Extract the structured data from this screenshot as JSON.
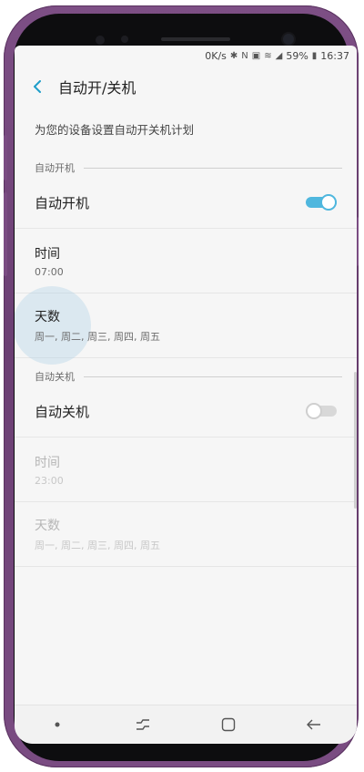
{
  "status_bar": {
    "net_speed": "0K/s",
    "battery": "59%",
    "time": "16:37"
  },
  "app_bar": {
    "title": "自动开/关机"
  },
  "description": "为您的设备设置自动开关机计划",
  "auto_on": {
    "section_label": "自动开机",
    "toggle_label": "自动开机",
    "enabled": true,
    "time_title": "时间",
    "time_value": "07:00",
    "days_title": "天数",
    "days_value": "周一, 周二, 周三, 周四, 周五"
  },
  "auto_off": {
    "section_label": "自动关机",
    "toggle_label": "自动关机",
    "enabled": false,
    "time_title": "时间",
    "time_value": "23:00",
    "days_title": "天数",
    "days_value": "周一, 周二, 周三, 周四, 周五"
  },
  "colors": {
    "accent": "#4fb7de",
    "phone_body": "#7d4f85"
  },
  "icons": [
    "back-arrow-icon",
    "recents-icon",
    "home-icon",
    "back-nav-icon",
    "bluetooth-icon",
    "nfc-icon",
    "wifi-icon",
    "signal-icon",
    "battery-icon"
  ]
}
